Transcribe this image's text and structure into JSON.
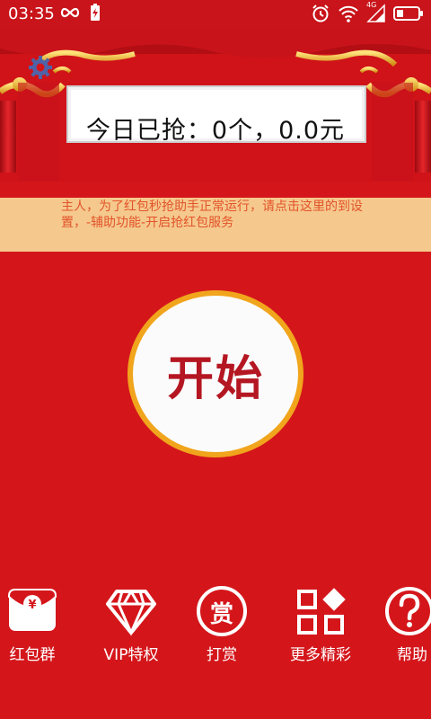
{
  "status_bar": {
    "time": "03:35",
    "network_label": "4G",
    "icons": [
      "infinity-icon",
      "battery-charging-icon",
      "alarm-icon",
      "wifi-icon",
      "signal-icon",
      "battery-icon"
    ]
  },
  "header": {
    "settings_icon": "gear-icon",
    "today_grabbed": "今日已抢：0个，0.0元"
  },
  "notice": {
    "text": "主人，为了红包秒抢助手正常运行，请点击这里的到设置，-辅助功能-开启抢红包服务"
  },
  "start_button": {
    "label": "开始"
  },
  "menu": {
    "items": [
      {
        "label": "红包群",
        "icon": "red-envelope-icon"
      },
      {
        "label": "VIP特权",
        "icon": "diamond-icon"
      },
      {
        "label": "打赏",
        "icon": "reward-icon"
      },
      {
        "label": "更多精彩",
        "icon": "grid-icon"
      },
      {
        "label": "帮助",
        "icon": "help-icon"
      }
    ],
    "reward_glyph": "赏"
  },
  "colors": {
    "background": "#d4161b",
    "notice_bg": "#f5c98d",
    "notice_text": "#e2532b",
    "button_ring": "#f1a51c",
    "button_text": "#b41722"
  }
}
